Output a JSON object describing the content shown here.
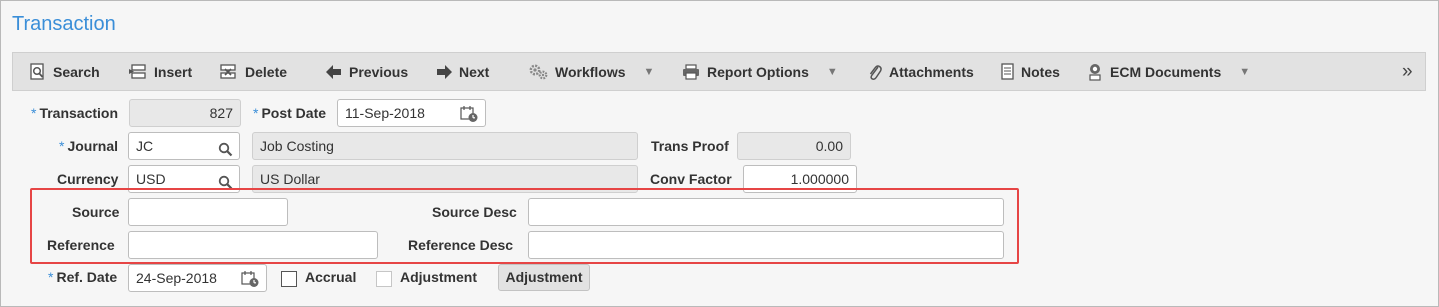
{
  "page": {
    "title": "Transaction"
  },
  "toolbar": {
    "search": "Search",
    "insert": "Insert",
    "delete": "Delete",
    "previous": "Previous",
    "next": "Next",
    "workflows": "Workflows",
    "report_options": "Report Options",
    "attachments": "Attachments",
    "notes": "Notes",
    "ecm_documents": "ECM Documents",
    "more": "»"
  },
  "form": {
    "required_marker": "*",
    "transaction": {
      "label": "Transaction",
      "value": "827"
    },
    "post_date": {
      "label": "Post Date",
      "value": "11-Sep-2018"
    },
    "journal": {
      "label": "Journal",
      "value": "JC",
      "description": "Job Costing"
    },
    "trans_proof": {
      "label": "Trans Proof",
      "value": "0.00"
    },
    "currency": {
      "label": "Currency",
      "value": "USD",
      "description": "US Dollar"
    },
    "conv_factor": {
      "label": "Conv Factor",
      "value": "1.000000"
    },
    "source": {
      "label": "Source",
      "value": ""
    },
    "source_desc": {
      "label": "Source Desc",
      "value": ""
    },
    "reference": {
      "label": "Reference",
      "value": ""
    },
    "reference_desc": {
      "label": "Reference Desc",
      "value": ""
    },
    "ref_date": {
      "label": "Ref. Date",
      "value": "24-Sep-2018"
    },
    "accrual": {
      "label": "Accrual",
      "checked": false
    },
    "adjustment": {
      "label": "Adjustment",
      "checked": false,
      "disabled": true
    },
    "adjustment_button": "Adjustment"
  },
  "colors": {
    "accent": "#3a8ed8",
    "highlight": "#e64545"
  }
}
